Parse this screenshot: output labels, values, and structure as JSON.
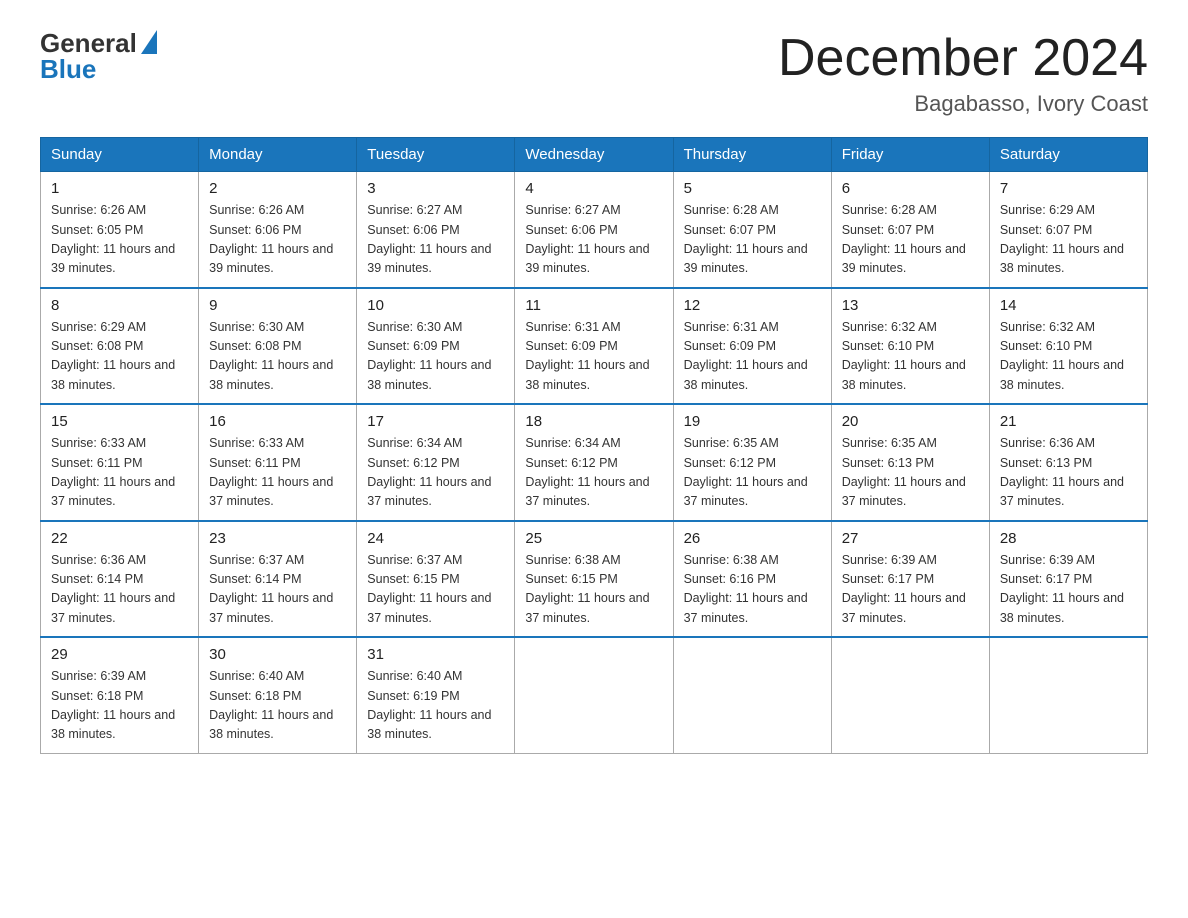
{
  "header": {
    "logo_general": "General",
    "logo_blue": "Blue",
    "month_title": "December 2024",
    "location": "Bagabasso, Ivory Coast"
  },
  "days_of_week": [
    "Sunday",
    "Monday",
    "Tuesday",
    "Wednesday",
    "Thursday",
    "Friday",
    "Saturday"
  ],
  "weeks": [
    [
      {
        "day": "1",
        "sunrise": "6:26 AM",
        "sunset": "6:05 PM",
        "daylight": "11 hours and 39 minutes."
      },
      {
        "day": "2",
        "sunrise": "6:26 AM",
        "sunset": "6:06 PM",
        "daylight": "11 hours and 39 minutes."
      },
      {
        "day": "3",
        "sunrise": "6:27 AM",
        "sunset": "6:06 PM",
        "daylight": "11 hours and 39 minutes."
      },
      {
        "day": "4",
        "sunrise": "6:27 AM",
        "sunset": "6:06 PM",
        "daylight": "11 hours and 39 minutes."
      },
      {
        "day": "5",
        "sunrise": "6:28 AM",
        "sunset": "6:07 PM",
        "daylight": "11 hours and 39 minutes."
      },
      {
        "day": "6",
        "sunrise": "6:28 AM",
        "sunset": "6:07 PM",
        "daylight": "11 hours and 39 minutes."
      },
      {
        "day": "7",
        "sunrise": "6:29 AM",
        "sunset": "6:07 PM",
        "daylight": "11 hours and 38 minutes."
      }
    ],
    [
      {
        "day": "8",
        "sunrise": "6:29 AM",
        "sunset": "6:08 PM",
        "daylight": "11 hours and 38 minutes."
      },
      {
        "day": "9",
        "sunrise": "6:30 AM",
        "sunset": "6:08 PM",
        "daylight": "11 hours and 38 minutes."
      },
      {
        "day": "10",
        "sunrise": "6:30 AM",
        "sunset": "6:09 PM",
        "daylight": "11 hours and 38 minutes."
      },
      {
        "day": "11",
        "sunrise": "6:31 AM",
        "sunset": "6:09 PM",
        "daylight": "11 hours and 38 minutes."
      },
      {
        "day": "12",
        "sunrise": "6:31 AM",
        "sunset": "6:09 PM",
        "daylight": "11 hours and 38 minutes."
      },
      {
        "day": "13",
        "sunrise": "6:32 AM",
        "sunset": "6:10 PM",
        "daylight": "11 hours and 38 minutes."
      },
      {
        "day": "14",
        "sunrise": "6:32 AM",
        "sunset": "6:10 PM",
        "daylight": "11 hours and 38 minutes."
      }
    ],
    [
      {
        "day": "15",
        "sunrise": "6:33 AM",
        "sunset": "6:11 PM",
        "daylight": "11 hours and 37 minutes."
      },
      {
        "day": "16",
        "sunrise": "6:33 AM",
        "sunset": "6:11 PM",
        "daylight": "11 hours and 37 minutes."
      },
      {
        "day": "17",
        "sunrise": "6:34 AM",
        "sunset": "6:12 PM",
        "daylight": "11 hours and 37 minutes."
      },
      {
        "day": "18",
        "sunrise": "6:34 AM",
        "sunset": "6:12 PM",
        "daylight": "11 hours and 37 minutes."
      },
      {
        "day": "19",
        "sunrise": "6:35 AM",
        "sunset": "6:12 PM",
        "daylight": "11 hours and 37 minutes."
      },
      {
        "day": "20",
        "sunrise": "6:35 AM",
        "sunset": "6:13 PM",
        "daylight": "11 hours and 37 minutes."
      },
      {
        "day": "21",
        "sunrise": "6:36 AM",
        "sunset": "6:13 PM",
        "daylight": "11 hours and 37 minutes."
      }
    ],
    [
      {
        "day": "22",
        "sunrise": "6:36 AM",
        "sunset": "6:14 PM",
        "daylight": "11 hours and 37 minutes."
      },
      {
        "day": "23",
        "sunrise": "6:37 AM",
        "sunset": "6:14 PM",
        "daylight": "11 hours and 37 minutes."
      },
      {
        "day": "24",
        "sunrise": "6:37 AM",
        "sunset": "6:15 PM",
        "daylight": "11 hours and 37 minutes."
      },
      {
        "day": "25",
        "sunrise": "6:38 AM",
        "sunset": "6:15 PM",
        "daylight": "11 hours and 37 minutes."
      },
      {
        "day": "26",
        "sunrise": "6:38 AM",
        "sunset": "6:16 PM",
        "daylight": "11 hours and 37 minutes."
      },
      {
        "day": "27",
        "sunrise": "6:39 AM",
        "sunset": "6:17 PM",
        "daylight": "11 hours and 37 minutes."
      },
      {
        "day": "28",
        "sunrise": "6:39 AM",
        "sunset": "6:17 PM",
        "daylight": "11 hours and 38 minutes."
      }
    ],
    [
      {
        "day": "29",
        "sunrise": "6:39 AM",
        "sunset": "6:18 PM",
        "daylight": "11 hours and 38 minutes."
      },
      {
        "day": "30",
        "sunrise": "6:40 AM",
        "sunset": "6:18 PM",
        "daylight": "11 hours and 38 minutes."
      },
      {
        "day": "31",
        "sunrise": "6:40 AM",
        "sunset": "6:19 PM",
        "daylight": "11 hours and 38 minutes."
      },
      null,
      null,
      null,
      null
    ]
  ]
}
